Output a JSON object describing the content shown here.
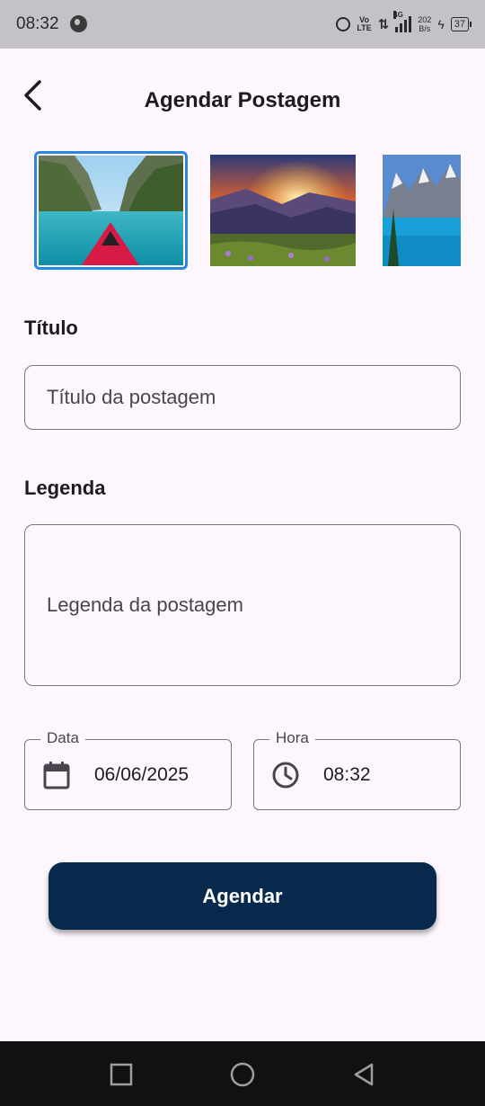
{
  "status_bar": {
    "time": "08:32",
    "network_type": "4G",
    "volte_top": "Vo",
    "volte_bottom": "LTE",
    "speed_value": "202",
    "speed_unit": "B/s",
    "battery": "37"
  },
  "header": {
    "title": "Agendar Postagem",
    "back_icon": "chevron-left-icon"
  },
  "images": [
    {
      "name": "kayak-lagoon",
      "selected": true
    },
    {
      "name": "mountain-sunset",
      "selected": false
    },
    {
      "name": "mountain-lake",
      "selected": false
    }
  ],
  "form": {
    "title_label": "Título",
    "title_placeholder": "Título da postagem",
    "title_value": "",
    "caption_label": "Legenda",
    "caption_placeholder": "Legenda da postagem",
    "caption_value": "",
    "date_label": "Data",
    "date_value": "06/06/2025",
    "date_icon": "calendar-icon",
    "time_label": "Hora",
    "time_value": "08:32",
    "time_icon": "clock-icon",
    "submit_label": "Agendar"
  },
  "colors": {
    "background": "#fdf7fd",
    "primary_button": "#06294c",
    "selected_border": "#2b86e0",
    "outline": "#79747e"
  },
  "nav_bar": {
    "icons": [
      "square-recents-icon",
      "circle-home-icon",
      "triangle-back-icon"
    ]
  }
}
